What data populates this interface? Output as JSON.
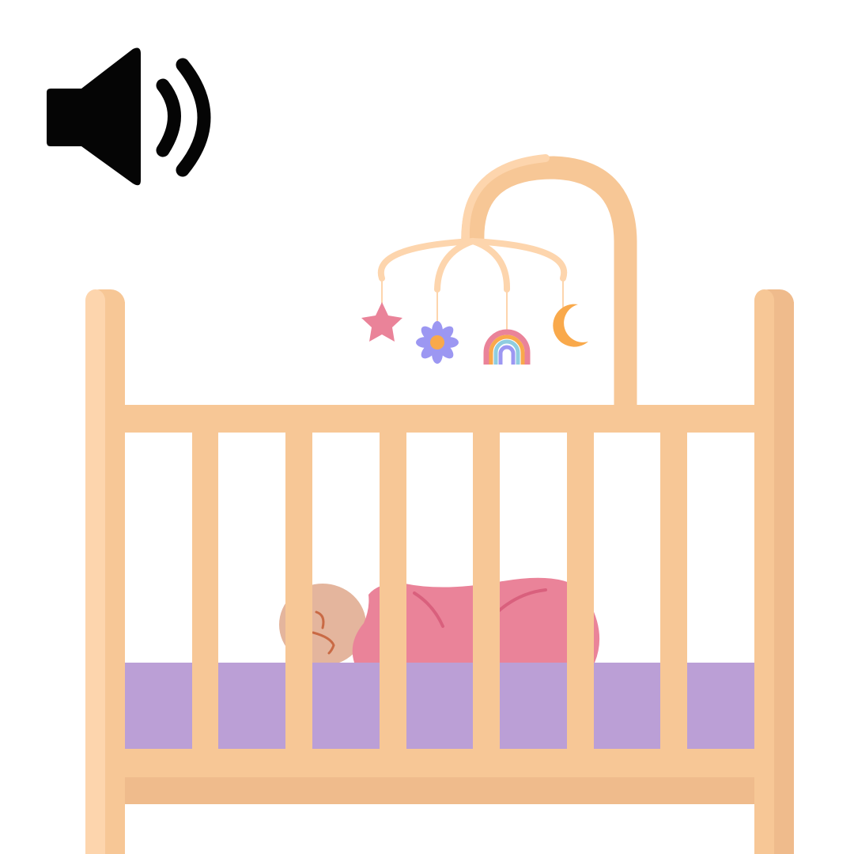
{
  "controls": {
    "audio_button": {
      "icon": "speaker-volume-icon"
    }
  },
  "illustration": {
    "subject": "sleeping-baby-in-crib",
    "icons": [
      "crib",
      "baby-mobile",
      "star-icon",
      "flower-icon",
      "rainbow-icon",
      "moon-icon",
      "sleeping-baby",
      "mattress"
    ]
  },
  "colors": {
    "wood_light": "#FDD5AD",
    "wood": "#F7C796",
    "wood_dark": "#EFBB8C",
    "mattress": "#BB9FD6",
    "blanket": "#EA8399",
    "blanket_line": "#D9607D",
    "skin": "#E4B59D",
    "face_line": "#C96A45",
    "star": "#EA8399",
    "flower": "#9C97F2",
    "flower_center": "#F9A94B",
    "moon": "#F9A94B",
    "speaker": "#050505"
  }
}
